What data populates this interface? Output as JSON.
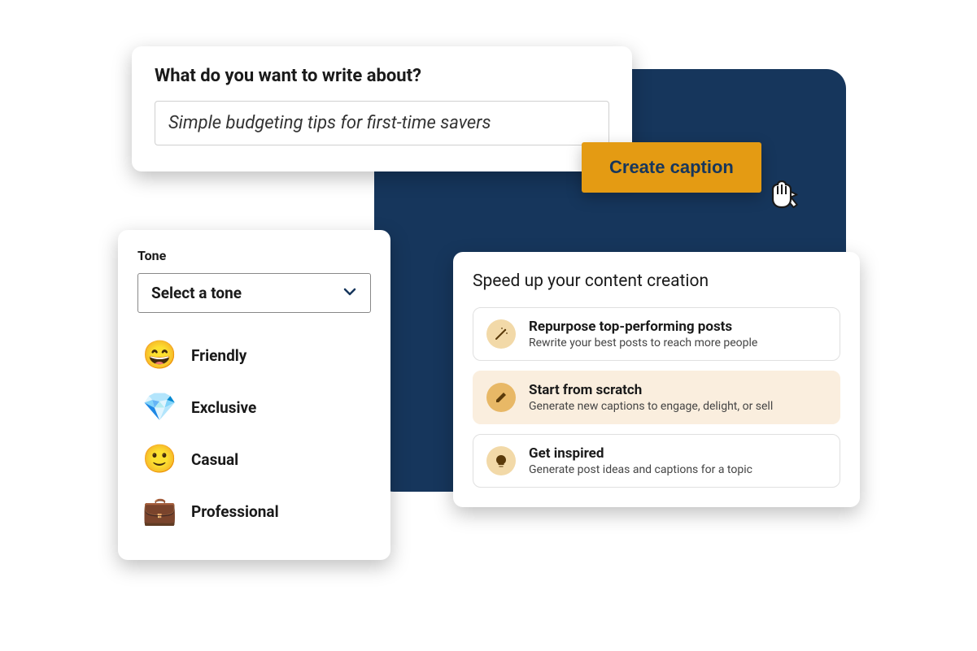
{
  "prompt": {
    "title": "What do you want to write about?",
    "input_value": "Simple budgeting tips for first-time savers"
  },
  "create_button_label": "Create caption",
  "tone": {
    "label": "Tone",
    "placeholder": "Select a tone",
    "options": [
      {
        "emoji": "😄",
        "label": "Friendly"
      },
      {
        "emoji": "💎",
        "label": "Exclusive"
      },
      {
        "emoji": "🙂",
        "label": "Casual"
      },
      {
        "emoji": "💼",
        "label": "Professional"
      }
    ]
  },
  "content": {
    "title": "Speed up your content creation",
    "options": [
      {
        "title": "Repurpose top-performing posts",
        "desc": "Rewrite your best posts to reach more people",
        "selected": false,
        "icon": "wand"
      },
      {
        "title": "Start from scratch",
        "desc": "Generate new captions to engage, delight, or sell",
        "selected": true,
        "icon": "pencil"
      },
      {
        "title": "Get inspired",
        "desc": "Generate post ideas and captions for a topic",
        "selected": false,
        "icon": "bulb"
      }
    ]
  }
}
